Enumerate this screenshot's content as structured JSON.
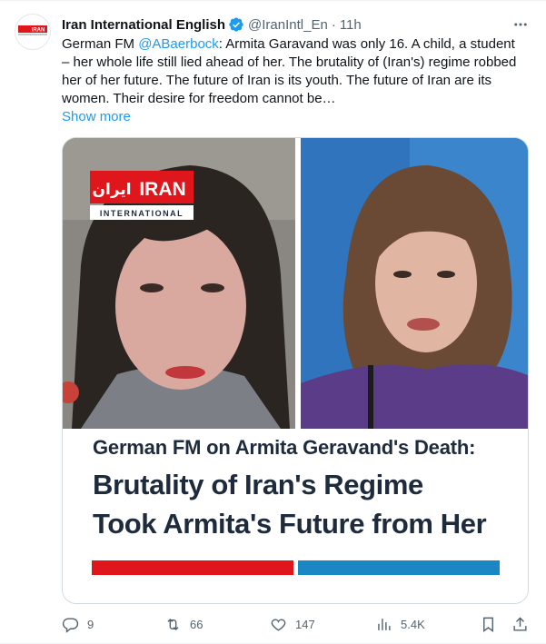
{
  "author": {
    "name": "Iran International English",
    "handle": "@IranIntl_En",
    "time": "11h",
    "separator": "·",
    "verified_color": "#1d9bf0",
    "avatar_logo_text": "IRAN"
  },
  "tweet": {
    "lines": [
      "German FM ",
      "@ABaerbock",
      ": Armita Garavand was only 16. A child, a student",
      "– her whole life still lied ahead of her. The brutality of (Iran's) regime robbed",
      "her of her future. The future of Iran is its youth. The future of Iran are its",
      "women. Their desire for freedom cannot be…"
    ],
    "show_more": "Show more"
  },
  "media": {
    "logo_text": "IRAN",
    "logo_arabic": "ایران",
    "logo_sub": "INTERNATIONAL",
    "subhead": "German FM on Armita Geravand's Death:",
    "headline_line1": "Brutality of Iran's Regime",
    "headline_line2": "Took Armita's Future from Her",
    "bar_colors": [
      "#e0161d",
      "#1a86c4"
    ]
  },
  "actions": {
    "replies": "9",
    "reposts": "66",
    "likes": "147",
    "views": "5.4K"
  },
  "colors": {
    "accent": "#1d9bf0",
    "muted": "#536471",
    "text": "#0f1419"
  }
}
